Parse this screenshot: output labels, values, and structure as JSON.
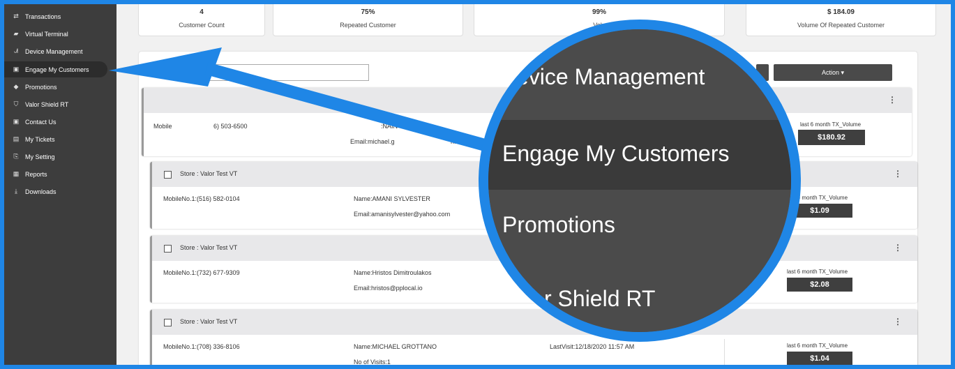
{
  "sidebar": {
    "items": [
      {
        "label": "Transactions",
        "icon": "transfer-icon",
        "glyph": "⇄"
      },
      {
        "label": "Virtual Terminal",
        "icon": "terminal-icon",
        "glyph": "▰"
      },
      {
        "label": "Device Management",
        "icon": "device-tree-icon",
        "glyph": "ᗂ"
      },
      {
        "label": "Engage My Customers",
        "icon": "contact-card-icon",
        "glyph": "▣"
      },
      {
        "label": "Promotions",
        "icon": "tag-icon",
        "glyph": "◆"
      },
      {
        "label": "Valor Shield RT",
        "icon": "shield-icon",
        "glyph": "⛉"
      },
      {
        "label": "Contact Us",
        "icon": "contact-icon",
        "glyph": "▣"
      },
      {
        "label": "My Tickets",
        "icon": "ticket-icon",
        "glyph": "▤"
      },
      {
        "label": "My Setting",
        "icon": "settings-icon",
        "glyph": "⎘"
      },
      {
        "label": "Reports",
        "icon": "report-icon",
        "glyph": "▦"
      },
      {
        "label": "Downloads",
        "icon": "download-icon",
        "glyph": "⤓"
      }
    ]
  },
  "stats": [
    {
      "value": "4",
      "label": "Customer Count"
    },
    {
      "value": "75%",
      "label": "Repeated Customer"
    },
    {
      "value": "99%",
      "label": "Volu"
    },
    {
      "value": "$ 184.09",
      "label": "Volume Of Repeated Customer"
    }
  ],
  "toolbar": {
    "action_label": "Action ▾"
  },
  "cards": [
    {
      "store": "",
      "mobile": "Mobile",
      "mobile2": "6) 503-6500",
      "name": ":NAIN",
      "email": "Email:michael.g",
      "email2": "h.com",
      "vol_label": "last 6 month TX_Volume",
      "vol": "$180.92"
    },
    {
      "store": "Store : Valor Test VT",
      "mobile": "MobileNo.1:(516) 582-0104",
      "name": "Name:AMANI SYLVESTER",
      "email": "Email:amanisylvester@yahoo.com",
      "vol_label": "last 6 month TX_Volume",
      "vol": "$1.09"
    },
    {
      "store": "Store : Valor Test VT",
      "mobile": "MobileNo.1:(732) 677-9309",
      "name": "Name:Hristos Dimitroulakos",
      "email": "Email:hristos@pplocal.io",
      "vol_label": "last 6 month TX_Volume",
      "vol": "$2.08"
    },
    {
      "store": "Store : Valor Test VT",
      "mobile": "MobileNo.1:(708) 336-8106",
      "name": "Name:MICHAEL GROTTANO",
      "visits": "No of Visits:1",
      "lastvisit": "LastVisit:12/18/2020 11:57 AM",
      "vol_label": "last 6 month TX_Volume",
      "vol": "$1.04"
    }
  ],
  "zoom": {
    "line1": "evice Management",
    "line2": "Engage My Customers",
    "line3": "Promotions",
    "line4": "r Shield RT"
  },
  "colors": {
    "accent": "#1f86e6",
    "sidebar": "#3d3d3d"
  }
}
